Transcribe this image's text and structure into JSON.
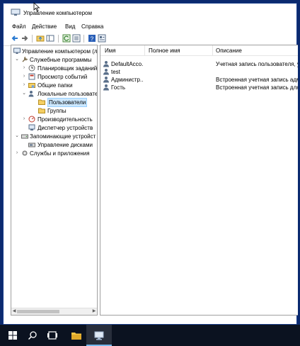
{
  "window": {
    "title": "Управление компьютером"
  },
  "menu": {
    "items": [
      "Файл",
      "Действие",
      "Вид",
      "Справка"
    ]
  },
  "tree": {
    "items": [
      {
        "label": "Управление компьютером (л",
        "level": 0,
        "expander": ""
      },
      {
        "label": "Служебные программы",
        "level": 1,
        "expander": "down"
      },
      {
        "label": "Планировщик заданий",
        "level": 2,
        "expander": "right"
      },
      {
        "label": "Просмотр событий",
        "level": 2,
        "expander": "right"
      },
      {
        "label": "Общие папки",
        "level": 2,
        "expander": "right"
      },
      {
        "label": "Локальные пользовате",
        "level": 2,
        "expander": "down"
      },
      {
        "label": "Пользователи",
        "level": 3,
        "expander": "",
        "selected": true
      },
      {
        "label": "Группы",
        "level": 3,
        "expander": ""
      },
      {
        "label": "Производительность",
        "level": 2,
        "expander": "right"
      },
      {
        "label": "Диспетчер устройств",
        "level": 2,
        "expander": ""
      },
      {
        "label": "Запоминающие устройст",
        "level": 1,
        "expander": "down"
      },
      {
        "label": "Управление дисками",
        "level": 2,
        "expander": ""
      },
      {
        "label": "Службы и приложения",
        "level": 1,
        "expander": "right"
      }
    ]
  },
  "list": {
    "columns": [
      "Имя",
      "Полное имя",
      "Описание"
    ],
    "rows": [
      {
        "name": "DefaultAcco...",
        "full_name": "",
        "description": "Учетная запись пользователя, у..."
      },
      {
        "name": "test",
        "full_name": "",
        "description": ""
      },
      {
        "name": "Администр...",
        "full_name": "",
        "description": "Встроенная учетная запись адм..."
      },
      {
        "name": "Гость",
        "full_name": "",
        "description": "Встроенная учетная запись для ..."
      }
    ]
  },
  "colors": {
    "desktop": "#0b2a6f",
    "taskbar": "#0b1220",
    "selection": "#cce8ff",
    "accent": "#76b9ed"
  }
}
